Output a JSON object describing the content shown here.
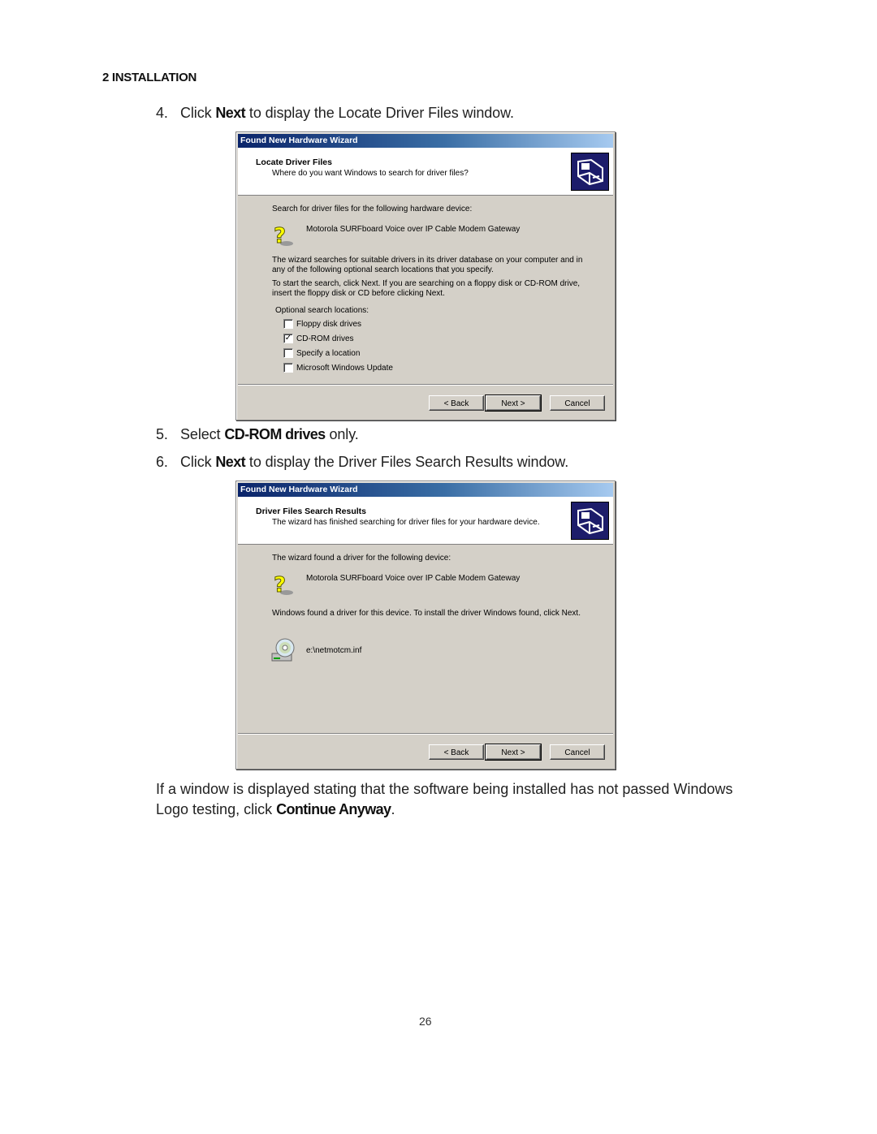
{
  "document": {
    "section_header": "2 INSTALLATION",
    "page_number": "26"
  },
  "steps": [
    {
      "num": "4.",
      "pre": "Click ",
      "bold": "Next",
      "post": " to display the Locate Driver Files window."
    },
    {
      "num": "5.",
      "pre": "Select ",
      "bold": "CD-ROM drives",
      "post": " only."
    },
    {
      "num": "6.",
      "pre": "Click ",
      "bold": "Next",
      "post": " to display the Driver Files Search Results window."
    }
  ],
  "closing_paragraph": {
    "pre": "If a window is displayed stating that the software being installed has not passed Windows Logo testing, click ",
    "bold": "Continue Anyway",
    "post": "."
  },
  "dialog1": {
    "title": "Found New Hardware Wizard",
    "header_title": "Locate Driver Files",
    "header_subtitle": "Where do you want Windows to search for driver files?",
    "intro": "Search for driver files for the following hardware device:",
    "device_name": "Motorola SURFboard Voice over IP Cable Modem Gateway",
    "desc_line1": "The wizard searches for suitable drivers in its driver database on your computer and in",
    "desc_line2": "any of the following optional search locations that you specify.",
    "desc_line3": "To start the search, click Next. If you are searching on a floppy disk or CD-ROM drive,",
    "desc_line4": "insert the floppy disk or CD before clicking Next.",
    "options_label": "Optional search locations:",
    "options": [
      {
        "label": "Floppy disk drives",
        "checked": false,
        "mark": ""
      },
      {
        "label": "CD-ROM drives",
        "checked": true,
        "mark": "✓"
      },
      {
        "label": "Specify a location",
        "checked": false,
        "mark": ""
      },
      {
        "label": "Microsoft Windows Update",
        "checked": false,
        "mark": ""
      }
    ],
    "buttons": {
      "back": "< Back",
      "next": "Next >",
      "cancel": "Cancel"
    }
  },
  "dialog2": {
    "title": "Found New Hardware Wizard",
    "header_title": "Driver Files Search Results",
    "header_subtitle": "The wizard has finished searching for driver files for your hardware device.",
    "intro": "The wizard found a driver for the following device:",
    "device_name": "Motorola SURFboard Voice over IP Cable Modem Gateway",
    "found_text": "Windows found a driver for this device. To install the driver Windows found, click Next.",
    "driver_file": "e:\\netmotcm.inf",
    "buttons": {
      "back": "< Back",
      "next": "Next >",
      "cancel": "Cancel"
    }
  }
}
